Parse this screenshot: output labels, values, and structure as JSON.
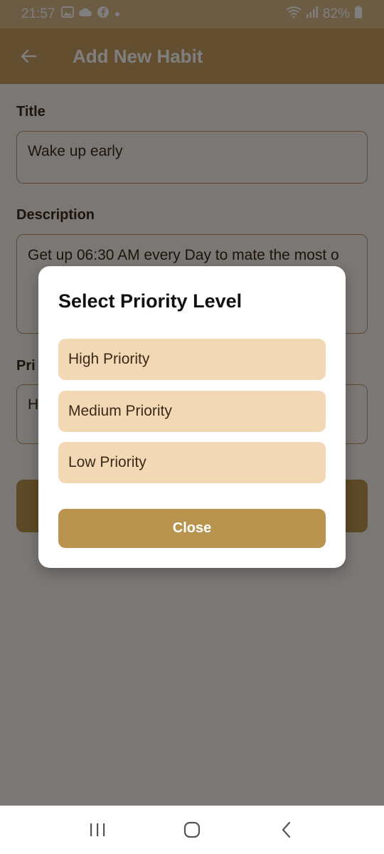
{
  "status": {
    "time": "21:57",
    "battery": "82%",
    "icons_left": [
      "gallery-icon",
      "cloud-icon",
      "facebook-icon",
      "dot-icon"
    ],
    "icons_right": [
      "wifi-icon",
      "signal-icon",
      "battery-icon"
    ]
  },
  "appbar": {
    "title": "Add New Habit"
  },
  "form": {
    "title_label": "Title",
    "title_value": "Wake up early",
    "description_label": "Description",
    "description_value": "Get up 06:30 AM every Day to mate the most o",
    "priority_label": "Pri",
    "priority_value": "H"
  },
  "dialog": {
    "title": "Select Priority Level",
    "options": [
      "High Priority",
      "Medium Priority",
      "Low Priority"
    ],
    "close_label": "Close"
  },
  "colors": {
    "status_bar": "#d8b889",
    "app_bar": "#c89c60",
    "option_bg": "#f2d8b5",
    "button_bg": "#b8944f"
  }
}
